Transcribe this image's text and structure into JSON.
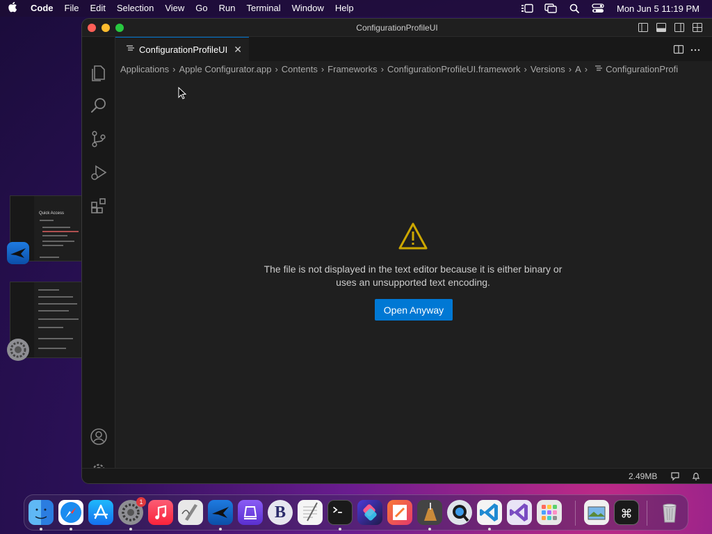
{
  "menubar": {
    "app_name": "Code",
    "items": [
      "File",
      "Edit",
      "Selection",
      "View",
      "Go",
      "Run",
      "Terminal",
      "Window",
      "Help"
    ],
    "clock": "Mon Jun 5  11:19 PM"
  },
  "thumbnails": {
    "top_title": "Quick Access"
  },
  "window": {
    "title": "ConfigurationProfileUI",
    "tab_label": "ConfigurationProfileUI",
    "breadcrumb": [
      "Applications",
      "Apple Configurator.app",
      "Contents",
      "Frameworks",
      "ConfigurationProfileUI.framework",
      "Versions",
      "A",
      "ConfigurationProfi"
    ],
    "message_line1": "The file is not displayed in the text editor because it is either binary or",
    "message_line2": "uses an unsupported text encoding.",
    "open_button": "Open Anyway",
    "file_size": "2.49MB"
  },
  "dock": {
    "settings_badge": "1",
    "bbedit_letter": "B",
    "apps": [
      "finder",
      "safari",
      "app-store",
      "system-settings",
      "music",
      "script-editor",
      "migrate",
      "tweaks",
      "bbedit",
      "textedit",
      "terminal",
      "shortcuts",
      "pages",
      "instruments",
      "quicktime",
      "vscode",
      "visual-studio",
      "launchpad",
      "preview",
      "keyboard-viewer",
      "trash"
    ]
  },
  "colors": {
    "accent": "#0078d4",
    "warning": "#cca700",
    "editor_bg": "#1f1f1f"
  }
}
